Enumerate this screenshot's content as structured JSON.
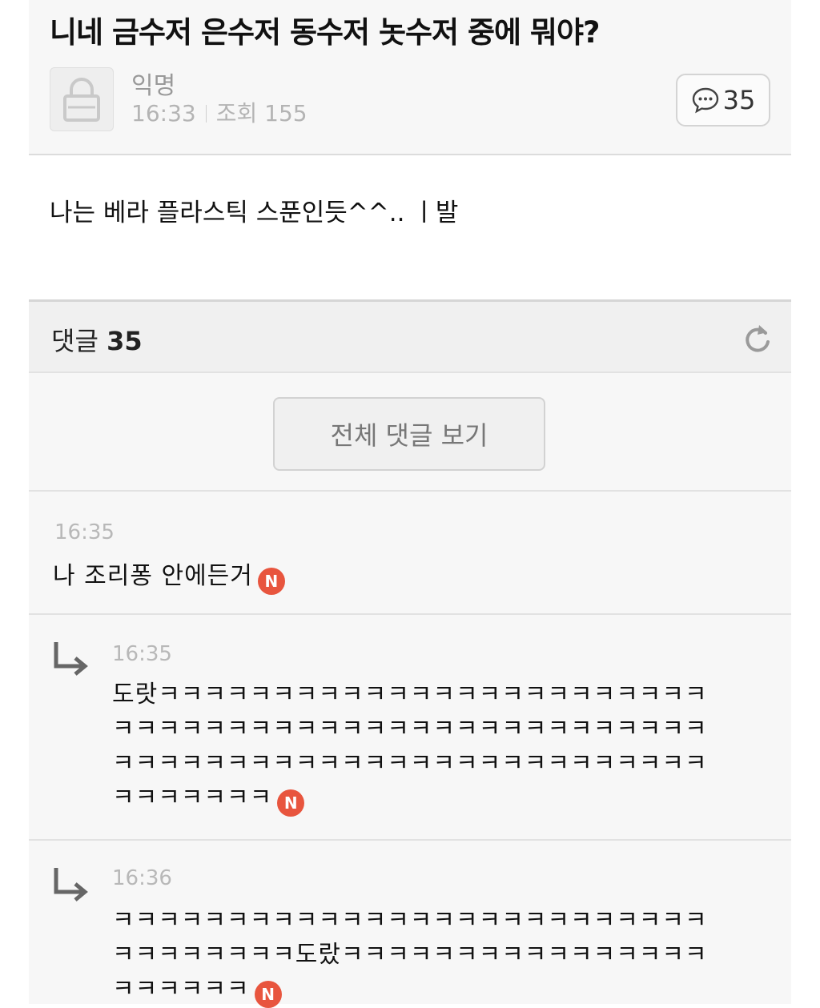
{
  "post": {
    "title": "니네 금수저 은수저 동수저 놋수저 중에 뭐야?",
    "author": "익명",
    "time": "16:33",
    "views_label": "조회 155",
    "comment_count": "35",
    "body": "나는 베라 플라스틱 스푼인듯^^.. ㅣ발"
  },
  "comments_header": {
    "label": "댓글",
    "count": "35"
  },
  "view_all_label": "전체 댓글 보기",
  "badge_label": "N",
  "comments": [
    {
      "time": "16:35",
      "text": "나 조리퐁 안에든거"
    },
    {
      "time": "16:35",
      "text": "도랏ㅋㅋㅋㅋㅋㅋㅋㅋㅋㅋㅋㅋㅋㅋㅋㅋㅋㅋㅋㅋㅋㅋㅋㅋㅋㅋㅋㅋㅋㅋㅋㅋㅋㅋㅋㅋㅋㅋㅋㅋㅋㅋㅋㅋㅋㅋㅋㅋㅋㅋㅋㅋㅋㅋㅋㅋㅋㅋㅋㅋㅋㅋㅋㅋㅋㅋㅋㅋㅋㅋㅋㅋㅋㅋㅋㅋㅋㅋㅋㅋㅋㅋㅋ"
    },
    {
      "time": "16:36",
      "text": "ㅋㅋㅋㅋㅋㅋㅋㅋㅋㅋㅋㅋㅋㅋㅋㅋㅋㅋㅋㅋㅋㅋㅋㅋㅋㅋㅋㅋㅋㅋㅋㅋㅋㅋ도랐ㅋㅋㅋㅋㅋㅋㅋㅋㅋㅋㅋㅋㅋㅋㅋㅋㅋㅋㅋㅋㅋㅋ"
    }
  ],
  "colors": {
    "badge": "#e8553e",
    "muted": "#b8b8b8"
  }
}
